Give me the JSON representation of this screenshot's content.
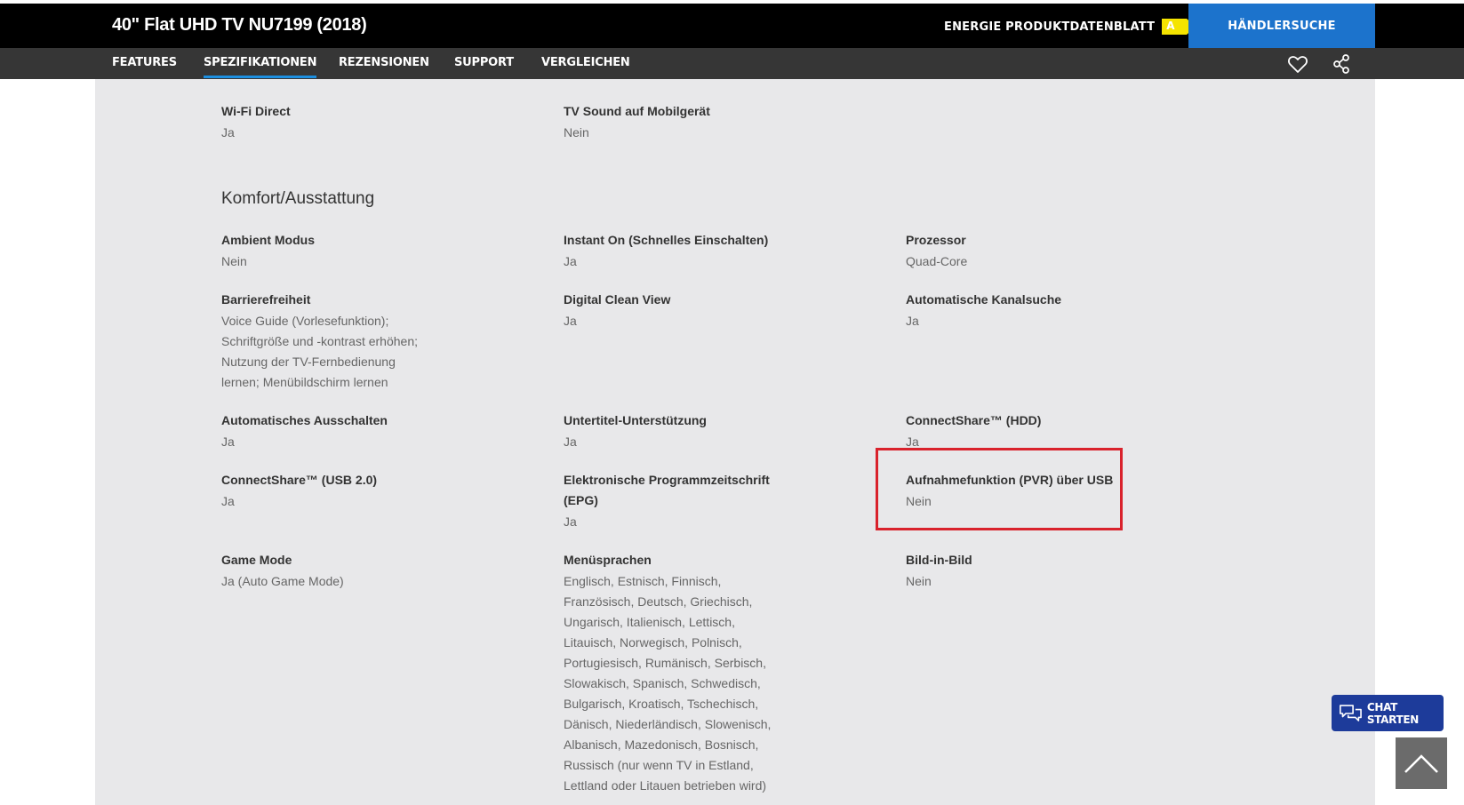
{
  "header": {
    "product_title": "40\" Flat UHD TV NU7199 (2018)",
    "energy_label": "ENERGIE PRODUKTDATENBLATT",
    "energy_class": "A",
    "dealer_button": "HÄNDLERSUCHE",
    "colors": {
      "bar": "#000000",
      "dealer": "#1c73cc",
      "energy_badge": "#f5e400"
    }
  },
  "nav": {
    "tabs": [
      "FEATURES",
      "SPEZIFIKATIONEN",
      "REZENSIONEN",
      "SUPPORT",
      "VERGLEICHEN"
    ],
    "active_tab": "SPEZIFIKATIONEN",
    "icons": [
      "heart-icon",
      "share-icon"
    ]
  },
  "specs": {
    "top_row": [
      {
        "label": "Wi-Fi Direct",
        "value": "Ja"
      },
      {
        "label": "TV Sound auf Mobilgerät",
        "value": "Nein"
      }
    ],
    "section_title": "Komfort/Ausstattung",
    "items": [
      {
        "label": "Ambient Modus",
        "value": "Nein"
      },
      {
        "label": "Instant On (Schnelles Einschalten)",
        "value": "Ja"
      },
      {
        "label": "Prozessor",
        "value": "Quad-Core"
      },
      {
        "label": "Barrierefreiheit",
        "value_lines": [
          "Voice Guide (Vorlesefunktion);",
          "Schriftgröße und -kontrast erhöhen;",
          "Nutzung der TV-Fernbedienung",
          "lernen; Menübildschirm lernen"
        ]
      },
      {
        "label": "Digital Clean View",
        "value": "Ja"
      },
      {
        "label": "Automatische Kanalsuche",
        "value": "Ja"
      },
      {
        "label": "Automatisches Ausschalten",
        "value": "Ja"
      },
      {
        "label": "Untertitel-Unterstützung",
        "value": "Ja"
      },
      {
        "label": "ConnectShare™ (HDD)",
        "value": "Ja"
      },
      {
        "label": "ConnectShare™ (USB 2.0)",
        "value": "Ja"
      },
      {
        "label_lines": [
          "Elektronische Programmzeitschrift",
          "(EPG)"
        ],
        "value": "Ja"
      },
      {
        "label": "Aufnahmefunktion (PVR) über USB",
        "value": "Nein"
      },
      {
        "label": "Game Mode",
        "value": "Ja (Auto Game Mode)"
      },
      {
        "label": "Menüsprachen",
        "value_lines": [
          "Englisch, Estnisch, Finnisch,",
          "Französisch, Deutsch, Griechisch,",
          "Ungarisch, Italienisch, Lettisch,",
          "Litauisch, Norwegisch, Polnisch,",
          "Portugiesisch, Rumänisch, Serbisch,",
          "Slowakisch, Spanisch, Schwedisch,",
          "Bulgarisch, Kroatisch, Tschechisch,",
          "Dänisch, Niederländisch, Slowenisch,",
          "Albanisch, Mazedonisch, Bosnisch,",
          "Russisch (nur wenn TV in Estland,",
          "Lettland oder Litauen betrieben wird)"
        ]
      },
      {
        "label": "Bild-in-Bild",
        "value": "Nein"
      }
    ],
    "highlight_color": "#d9222c"
  },
  "floating": {
    "chat_button": "CHAT STARTEN",
    "chat_icon": "chat-icon",
    "scroll_icon": "chevron-up-icon"
  }
}
